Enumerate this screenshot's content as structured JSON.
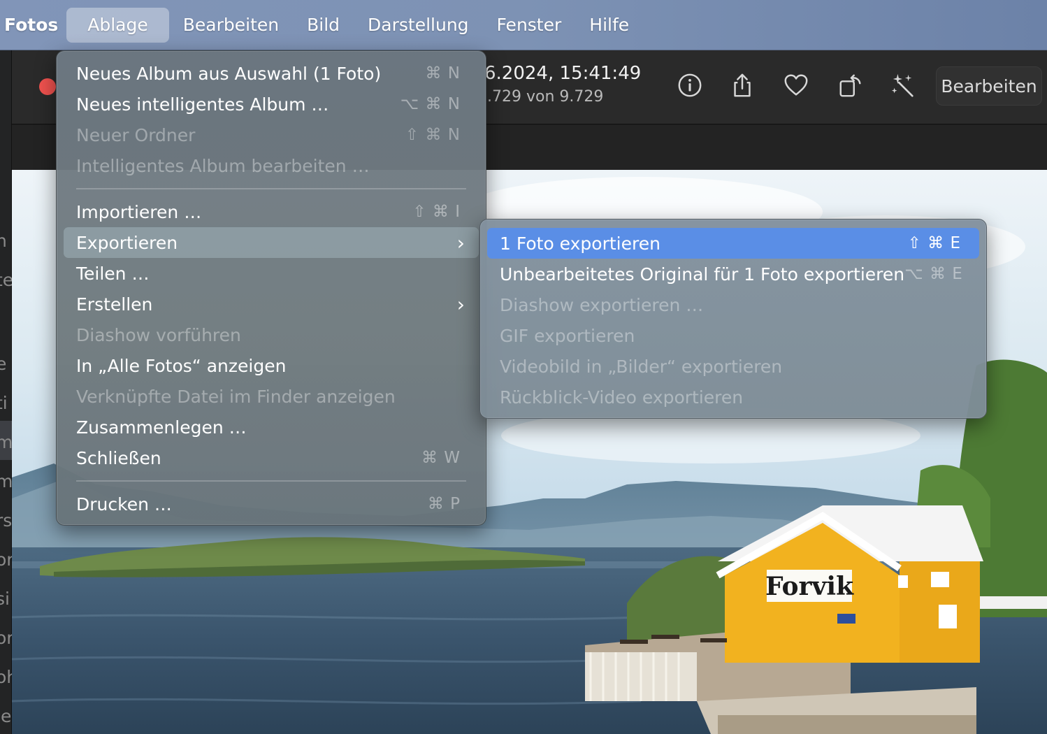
{
  "menubar": {
    "app": "Fotos",
    "items": [
      "Ablage",
      "Bearbeiten",
      "Bild",
      "Darstellung",
      "Fenster",
      "Hilfe"
    ],
    "active": "Ablage"
  },
  "left_strip_fragments": [
    "h",
    "te",
    "e",
    "ti",
    "m",
    "m",
    "rs",
    "or",
    "si",
    "or",
    "oh",
    "le"
  ],
  "window": {
    "date": "6.2024, 15:41:49",
    "count": ".729 von 9.729",
    "edit_label": "Bearbeiten",
    "icons": [
      "info-icon",
      "share-icon",
      "heart-icon",
      "rotate-icon",
      "magic-wand-icon"
    ]
  },
  "photo": {
    "sign_text": "Forvik"
  },
  "ablage_menu": {
    "items": [
      {
        "label": "Neues Album aus Auswahl (1 Foto)",
        "shortcut": "⌘ N",
        "enabled": true
      },
      {
        "label": "Neues intelligentes Album …",
        "shortcut": "⌥ ⌘ N",
        "enabled": true
      },
      {
        "label": "Neuer Ordner",
        "shortcut": "⇧ ⌘ N",
        "enabled": false
      },
      {
        "label": "Intelligentes Album bearbeiten …",
        "shortcut": "",
        "enabled": false
      },
      {
        "label": "Importieren …",
        "shortcut": "⇧ ⌘ I",
        "enabled": true
      },
      {
        "label": "Exportieren",
        "shortcut": "",
        "enabled": true,
        "submenu": true,
        "highlighted": true
      },
      {
        "label": "Teilen …",
        "shortcut": "",
        "enabled": true
      },
      {
        "label": "Erstellen",
        "shortcut": "",
        "enabled": true,
        "submenu": true
      },
      {
        "label": "Diashow vorführen",
        "shortcut": "",
        "enabled": false
      },
      {
        "label": "In „Alle Fotos“ anzeigen",
        "shortcut": "",
        "enabled": true
      },
      {
        "label": "Verknüpfte Datei im Finder anzeigen",
        "shortcut": "",
        "enabled": false
      },
      {
        "label": "Zusammenlegen …",
        "shortcut": "",
        "enabled": true
      },
      {
        "label": "Schließen",
        "shortcut": "⌘ W",
        "enabled": true
      },
      {
        "label": "Drucken …",
        "shortcut": "⌘ P",
        "enabled": true
      }
    ]
  },
  "export_submenu": {
    "items": [
      {
        "label": "1 Foto exportieren",
        "shortcut": "⇧ ⌘ E",
        "enabled": true,
        "selected": true
      },
      {
        "label": "Unbearbeitetes Original für 1 Foto exportieren",
        "shortcut": "⌥ ⌘ E",
        "enabled": true
      },
      {
        "label": "Diashow exportieren …",
        "shortcut": "",
        "enabled": false
      },
      {
        "label": "GIF exportieren",
        "shortcut": "",
        "enabled": false
      },
      {
        "label": "Videobild in „Bilder“ exportieren",
        "shortcut": "",
        "enabled": false
      },
      {
        "label": "Rückblick-Video exportieren",
        "shortcut": "",
        "enabled": false
      }
    ]
  },
  "colors": {
    "menu_selection": "#5a8ee6",
    "close_button": "#f0524f",
    "house": "#f2b21f"
  }
}
